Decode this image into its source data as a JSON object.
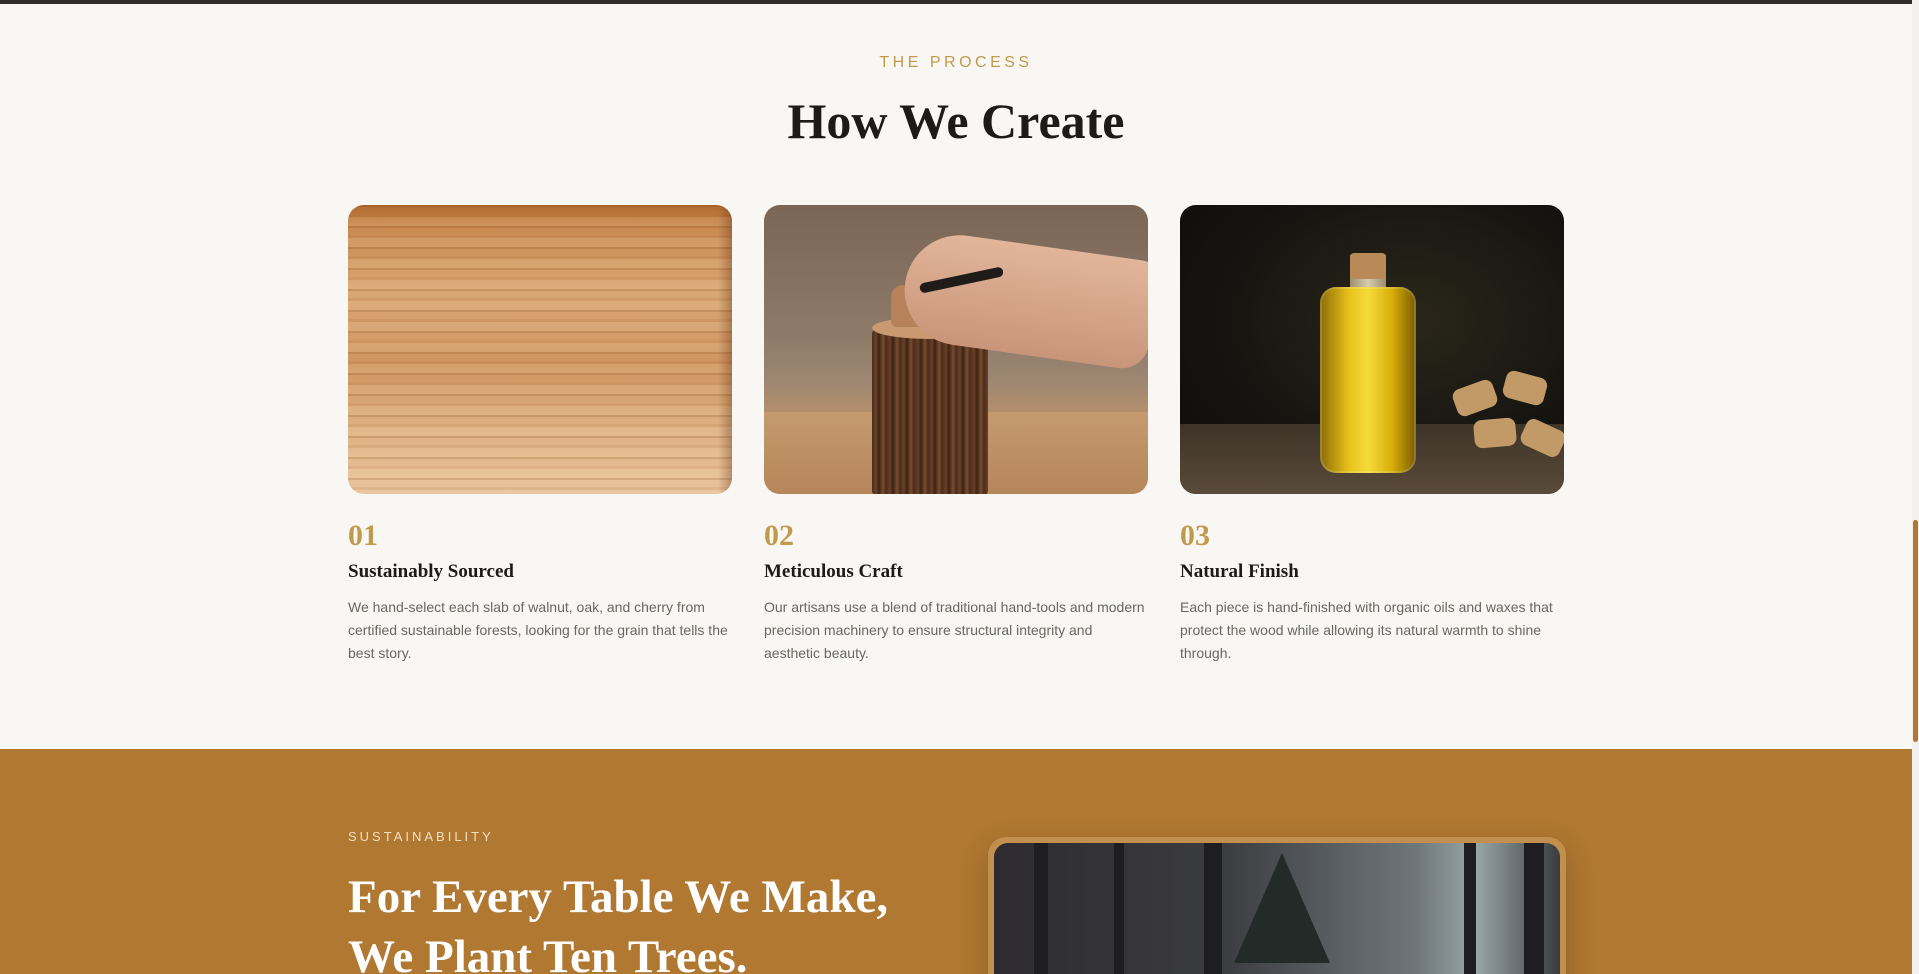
{
  "process": {
    "eyebrow": "THE PROCESS",
    "title": "How We Create",
    "steps": [
      {
        "number": "01",
        "title": "Sustainably Sourced",
        "description": "We hand-select each slab of walnut, oak, and cherry from certified sustainable forests, looking for the grain that tells the best story."
      },
      {
        "number": "02",
        "title": "Meticulous Craft",
        "description": "Our artisans use a blend of traditional hand-tools and modern precision machinery to ensure structural integrity and aesthetic beauty."
      },
      {
        "number": "03",
        "title": "Natural Finish",
        "description": "Each piece is hand-finished with organic oils and waxes that protect the wood while allowing its natural warmth to shine through."
      }
    ]
  },
  "sustainability": {
    "eyebrow": "SUSTAINABILITY",
    "title_line1": "For Every Table We Make,",
    "title_line2": "We Plant Ten Trees."
  },
  "colors": {
    "accent_gold": "#c29a4b",
    "sustainability_bg": "#b07831",
    "page_bg": "#f8f7f4"
  }
}
